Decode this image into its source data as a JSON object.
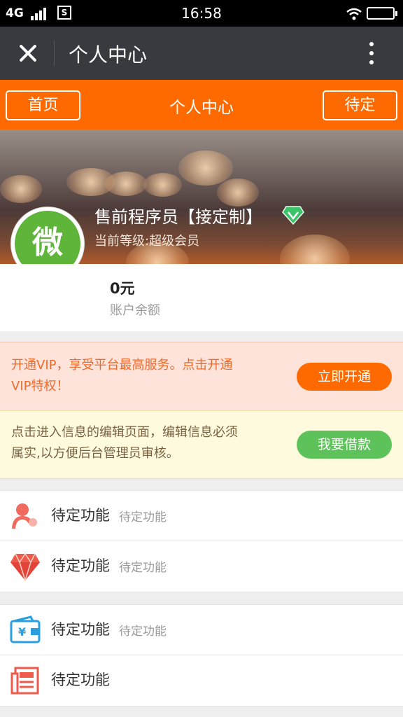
{
  "status_bar": {
    "network": "4G",
    "time": "16:58"
  },
  "titlebar": {
    "title": "个人中心"
  },
  "header": {
    "home_label": "首页",
    "title": "个人中心",
    "right_label": "待定"
  },
  "profile": {
    "username": "售前程序员【接定制】",
    "level": "当前等级:超级会员",
    "avatar_text": "微",
    "balance": "0元",
    "balance_label": "账户余额"
  },
  "vip_promo": {
    "text_line1": "开通VIP，享受平台最高服务。点击开通",
    "text_line2": "VIP特权！",
    "button": "立即开通"
  },
  "loan_promo": {
    "text_line1": "点击进入信息的编辑页面，编辑信息必须",
    "text_line2": "属实,以方便后台管理员审核。",
    "button": "我要借款"
  },
  "menu": [
    {
      "label": "待定功能",
      "sublabel": "待定功能",
      "icon": "user-icon"
    },
    {
      "label": "待定功能",
      "sublabel": "待定功能",
      "icon": "gem-icon"
    },
    {
      "label": "待定功能",
      "sublabel": "待定功能",
      "icon": "wallet-icon"
    },
    {
      "label": "待定功能",
      "sublabel": "",
      "icon": "document-icon"
    }
  ],
  "colors": {
    "accent": "#ff6a00",
    "titlebar": "#393a3f",
    "loan_button": "#5dc25a",
    "avatar": "#5fb53a"
  }
}
